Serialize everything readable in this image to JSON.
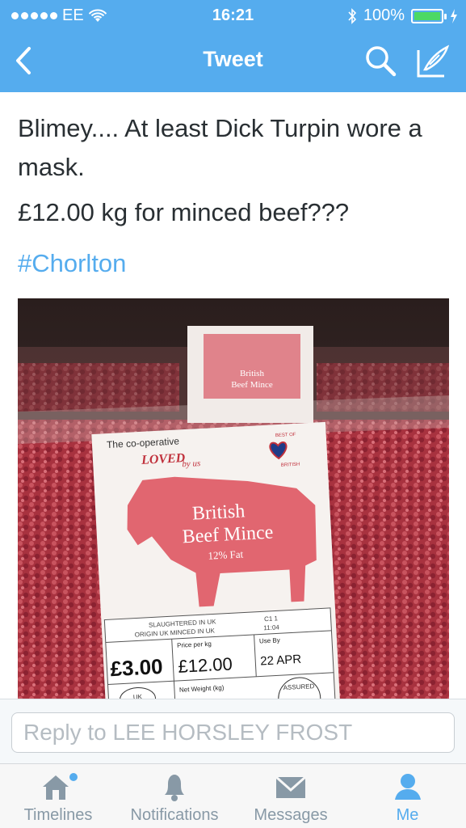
{
  "status_bar": {
    "carrier": "EE",
    "time": "16:21",
    "battery": "100%"
  },
  "nav": {
    "title": "Tweet",
    "back_icon": "chevron-left-icon",
    "search_icon": "search-icon",
    "compose_icon": "compose-icon"
  },
  "tweet": {
    "text_line1": "Blimey.... At least Dick Turpin wore a mask.",
    "text_line2": "£12.00 kg for minced beef???",
    "hashtag": "#Chorlton"
  },
  "photo": {
    "brand": "The co-operative",
    "loved": "LOVED",
    "by_us": "by us",
    "product_line1": "British",
    "product_line2": "Beef Mince",
    "fat": "12% Fat",
    "best_of": "BEST OF",
    "british": "BRITISH",
    "slaughtered": "SLAUGHTERED IN UK",
    "origin": "ORIGIN UK   MINCED IN UK",
    "code": "C1 1",
    "code_time": "11:04",
    "price_per_kg_label": "Price per kg",
    "use_by_label": "Use By",
    "price": "£3.00",
    "price_per_kg": "£12.00",
    "use_by": "22 APR",
    "uk_label": "UK",
    "net_weight_label": "Net Weight (kg)",
    "assured": "ASSURED",
    "back_pack_line1": "British",
    "back_pack_line2": "Beef Mince"
  },
  "reply": {
    "placeholder": "Reply to LEE HORSLEY FROST"
  },
  "tabs": [
    {
      "label": "Timelines",
      "icon": "home-icon"
    },
    {
      "label": "Notifications",
      "icon": "bell-icon"
    },
    {
      "label": "Messages",
      "icon": "envelope-icon"
    },
    {
      "label": "Me",
      "icon": "person-icon"
    }
  ],
  "colors": {
    "twitter_blue": "#55acee",
    "tab_inactive": "#8899a6",
    "battery_green": "#4cd964"
  }
}
